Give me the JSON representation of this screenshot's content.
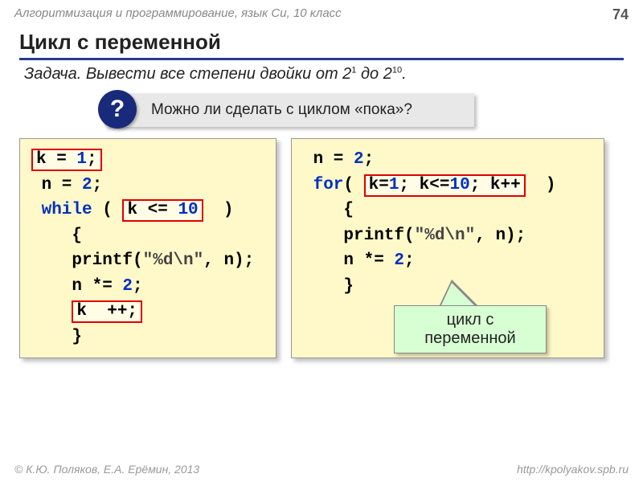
{
  "header": {
    "course": "Алгоритмизация и программирование, язык Си, 10 класс",
    "pageNum": "74"
  },
  "title": "Цикл с переменной",
  "task": {
    "label": "Задача",
    "text": ". Вывести все степени двойки от 2",
    "sup1": "1",
    "mid": " до 2",
    "sup2": "10",
    "end": "."
  },
  "question": {
    "badge": "?",
    "text": " Можно ли сделать с циклом «пока»?"
  },
  "codeLeft": {
    "l1a": "k = ",
    "l1n": "1",
    "l1b": ";",
    "l2a": " n = ",
    "l2n": "2",
    "l2b": ";",
    "l3kw": " while",
    "l3a": " ( ",
    "l3hla": "k <= ",
    "l3hln": "10",
    "l3b": "  )",
    "l4": "    {",
    "l5a": "    printf(",
    "l5s": "\"%d\\n\"",
    "l5b": ", n);",
    "l6a": "    n *= ",
    "l6n": "2",
    "l6b": ";",
    "l7hl": "k  ++;",
    "l8": "    }"
  },
  "codeRight": {
    "l1a": " n = ",
    "l1n": "2",
    "l1b": ";",
    "l2kw": " for",
    "l2a": "( ",
    "l2hla": "k=",
    "l2hln1": "1",
    "l2hlb": "; k<=",
    "l2hln2": "10",
    "l2hlc": "; k++",
    "l2b": "  )",
    "l3": "    {",
    "l4a": "    printf(",
    "l4s": "\"%d\\n\"",
    "l4b": ", n);",
    "l5a": "    n *= ",
    "l5n": "2",
    "l5b": ";",
    "l6": "    }"
  },
  "callout": {
    "line1": "цикл с",
    "line2": "переменной"
  },
  "footer": {
    "left": "К.Ю. Поляков, Е.А. Ерёмин, 2013",
    "right": "http://kpolyakov.spb.ru"
  }
}
